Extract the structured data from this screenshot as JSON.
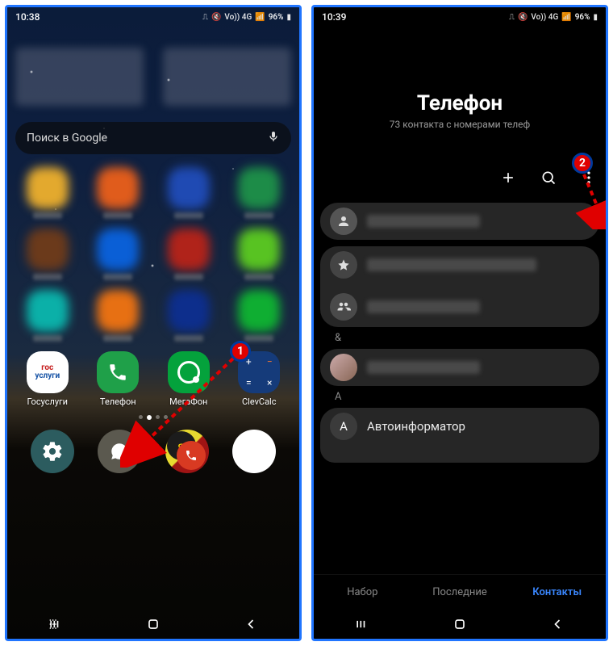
{
  "left": {
    "status_time": "10:38",
    "status_battery": "96%",
    "status_net": "Vo)) 4G",
    "search_placeholder": "Поиск в Google",
    "dock_apps": {
      "gos": {
        "label": "Госуслуги",
        "top": "гос",
        "bottom": "услуги"
      },
      "phone": {
        "label": "Телефон"
      },
      "megafon": {
        "label": "МегаФон"
      },
      "clevcalc": {
        "label": "ClevCalc"
      }
    },
    "callout": "1"
  },
  "right": {
    "status_time": "10:39",
    "status_battery": "96%",
    "status_net": "Vo)) 4G",
    "title": "Телефон",
    "subtitle": "73 контакта с номерами телеф",
    "index_amp": "&",
    "index_a": "A",
    "contact_a_name": "Автоинформатор",
    "contact_a_letter": "A",
    "tabs": {
      "dial": "Набор",
      "recent": "Последние",
      "contacts": "Контакты"
    },
    "callout": "2"
  }
}
